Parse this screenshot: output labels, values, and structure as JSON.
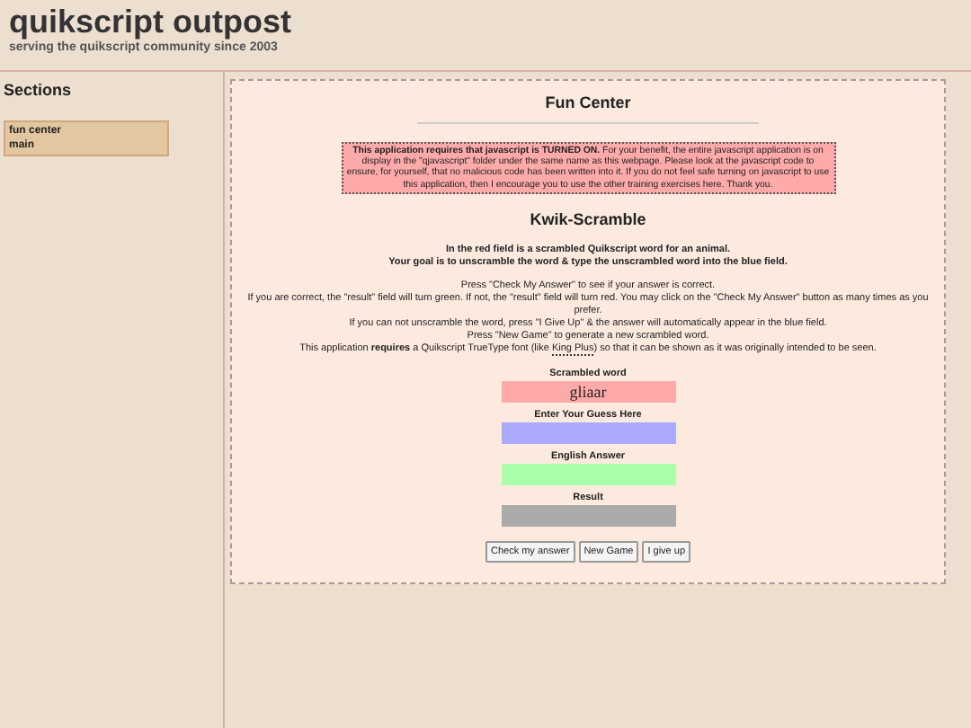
{
  "header": {
    "title": "quikscript outpost",
    "tagline": "serving the quikscript community since 2003"
  },
  "sidebar": {
    "title": "Sections",
    "items": [
      {
        "label": "fun center",
        "selected": false
      },
      {
        "label": "main",
        "selected": false
      }
    ]
  },
  "main": {
    "title": "Fun Center",
    "warning": "**This application requires that javascript is TURNED ON.** For your benefit, the entire javascript application is on display in the \"qjavascript\" folder under the same name as this webpage. Please look at the javascript code to ensure, for yourself, that no malicious code has been written into it. If you do not feel safe turning on javascript to use this application, then I encourage you to use the other training exercises here. Thank you.",
    "game_title": "Kwik-Scramble",
    "goal": [
      "In the red field is a scrambled Quikscript word for an animal.",
      "Your goal is to unscramble the word & type the unscrambled word into the blue field."
    ],
    "instructions": [
      "Press \"Check My Answer\" to see if your answer is correct.",
      "If you are correct, the \"result\" field will turn green. If not, the \"result\" field will turn red. You may click on the \"Check My Answer\" button as many times as you prefer.",
      "If you can not unscramble the word, press \"I Give Up\" & the answer will automatically appear in the blue field.",
      "Press \"New Game\" to generate a new scrambled word."
    ],
    "font_note": {
      "before": "This application **requires** a Quikscript TrueType font (like ",
      "link": "King Plus",
      "after": ") so that it can be shown as it was originally intended to be seen."
    },
    "fields": [
      {
        "label": "Scrambled word",
        "value": "gliaar",
        "color": "#ffaaaa"
      },
      {
        "label": "Enter Your Guess Here",
        "color": "#aaaaff"
      },
      {
        "label": "English Answer",
        "color": "#aaffaa"
      },
      {
        "label": "Result",
        "color": "#aaaaaa"
      }
    ],
    "buttons": [
      "Check my answer",
      "New Game",
      "I give up"
    ]
  }
}
